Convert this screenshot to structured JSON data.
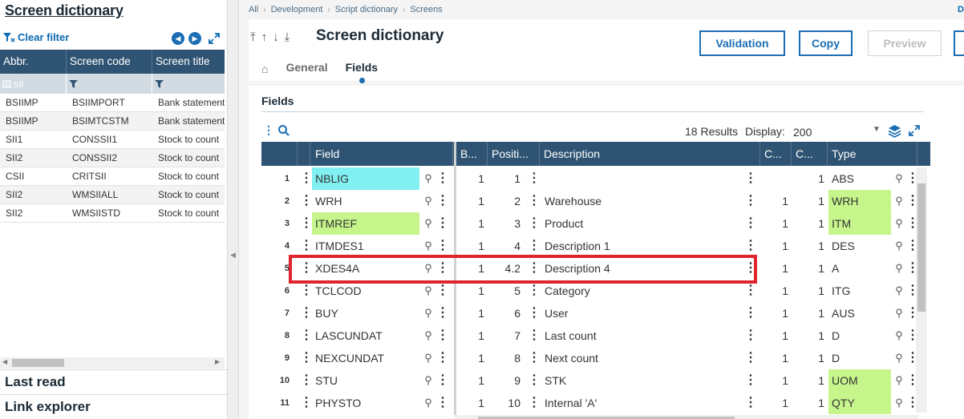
{
  "left": {
    "title": "Screen dictionary",
    "clear_filter": "Clear filter",
    "columns": [
      "Abbr.",
      "Screen code",
      "Screen title"
    ],
    "filter_value": "sii",
    "rows": [
      [
        "BSIIMP",
        "BSIIMPORT",
        "Bank statement"
      ],
      [
        "BSIIMP",
        "BSIMTCSTM",
        "Bank statement"
      ],
      [
        "SII1",
        "CONSSII1",
        "Stock to count"
      ],
      [
        "SII2",
        "CONSSII2",
        "Stock to count"
      ],
      [
        "CSII",
        "CRITSII",
        "Stock to count"
      ],
      [
        "SII2",
        "WMSIIALL",
        "Stock to count"
      ],
      [
        "SII2",
        "WMSIISTD",
        "Stock to count"
      ]
    ],
    "sections": [
      "Last read",
      "Link explorer"
    ]
  },
  "breadcrumb": [
    "All",
    "Development",
    "Script dictionary",
    "Screens"
  ],
  "header": {
    "title": "Screen dictionary",
    "buttons": {
      "validation": "Validation",
      "copy": "Copy",
      "preview": "Preview"
    }
  },
  "tabs": [
    "General",
    "Fields"
  ],
  "fields": {
    "title": "Fields",
    "results": "18 Results",
    "display_label": "Display:",
    "display_value": "200",
    "columns": [
      "Field",
      "B...",
      "Positi...",
      "Description",
      "C...",
      "C...",
      "Type"
    ],
    "rows": [
      {
        "n": "1",
        "field": "NBLIG",
        "b": "1",
        "pos": "1",
        "desc": "",
        "c1": "",
        "c2": "1",
        "type": "ABS"
      },
      {
        "n": "2",
        "field": "WRH",
        "b": "1",
        "pos": "2",
        "desc": "Warehouse",
        "c1": "1",
        "c2": "1",
        "type": "WRH"
      },
      {
        "n": "3",
        "field": "ITMREF",
        "b": "1",
        "pos": "3",
        "desc": "Product",
        "c1": "1",
        "c2": "1",
        "type": "ITM"
      },
      {
        "n": "4",
        "field": "ITMDES1",
        "b": "1",
        "pos": "4",
        "desc": "Description 1",
        "c1": "1",
        "c2": "1",
        "type": "DES"
      },
      {
        "n": "5",
        "field": "XDES4A",
        "b": "1",
        "pos": "4.2",
        "desc": "Description 4",
        "c1": "1",
        "c2": "1",
        "type": "A"
      },
      {
        "n": "6",
        "field": "TCLCOD",
        "b": "1",
        "pos": "5",
        "desc": "Category",
        "c1": "1",
        "c2": "1",
        "type": "ITG"
      },
      {
        "n": "7",
        "field": "BUY",
        "b": "1",
        "pos": "6",
        "desc": "User",
        "c1": "1",
        "c2": "1",
        "type": "AUS"
      },
      {
        "n": "8",
        "field": "LASCUNDAT",
        "b": "1",
        "pos": "7",
        "desc": "Last count",
        "c1": "1",
        "c2": "1",
        "type": "D"
      },
      {
        "n": "9",
        "field": "NEXCUNDAT",
        "b": "1",
        "pos": "8",
        "desc": "Next count",
        "c1": "1",
        "c2": "1",
        "type": "D"
      },
      {
        "n": "10",
        "field": "STU",
        "b": "1",
        "pos": "9",
        "desc": "STK",
        "c1": "1",
        "c2": "1",
        "type": "UOM"
      },
      {
        "n": "11",
        "field": "PHYSTO",
        "b": "1",
        "pos": "10",
        "desc": "Internal 'A'",
        "c1": "1",
        "c2": "1",
        "type": "QTY"
      }
    ]
  },
  "colors": {
    "header_bg": "#2f5473",
    "accent": "#1b6eb4",
    "highlight_cyan": "#80f0f2",
    "highlight_green": "#c6f58c",
    "callout_red": "#e0242d"
  }
}
